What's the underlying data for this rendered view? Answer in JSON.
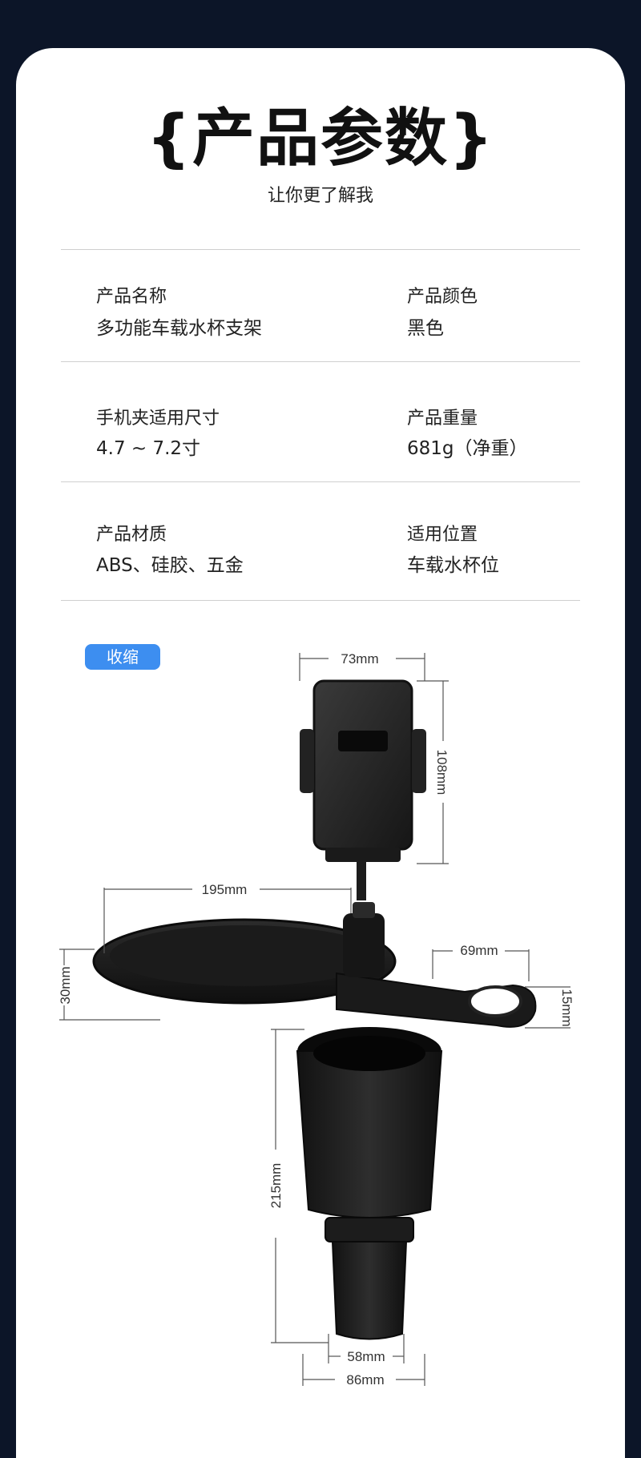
{
  "header": {
    "title": "{产品参数}",
    "subtitle": "让你更了解我"
  },
  "params": [
    {
      "label": "产品名称",
      "value": "多功能车载水杯支架"
    },
    {
      "label": "产品颜色",
      "value": "黑色"
    },
    {
      "label": "手机夹适用尺寸",
      "value": "4.7 ~ 7.2寸"
    },
    {
      "label": "产品重量",
      "value": "681g（净重）"
    },
    {
      "label": "产品材质",
      "value": "ABS、硅胶、五金"
    },
    {
      "label": "适用位置",
      "value": "车载水杯位"
    }
  ],
  "diagram": {
    "badge": "收缩",
    "dimensions": {
      "phone_width": "73mm",
      "phone_height": "108mm",
      "tray_width": "195mm",
      "tray_height": "30mm",
      "ring_width": "69mm",
      "ring_height": "15mm",
      "cup_height": "215mm",
      "base_inner": "58mm",
      "base_outer": "86mm"
    }
  }
}
